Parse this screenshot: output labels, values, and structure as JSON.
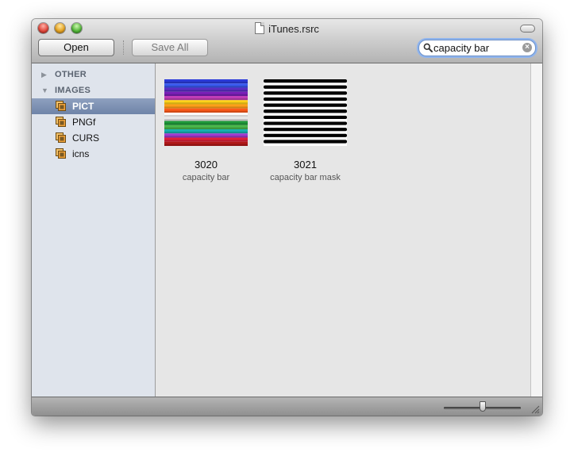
{
  "window": {
    "title": "iTunes.rsrc"
  },
  "toolbar": {
    "open_label": "Open",
    "save_all_label": "Save All"
  },
  "search": {
    "query": "capacity bar"
  },
  "sidebar": {
    "groups": [
      {
        "label": "OTHER",
        "expanded": false
      },
      {
        "label": "IMAGES",
        "expanded": true
      }
    ],
    "items": [
      {
        "label": "PICT",
        "selected": true
      },
      {
        "label": "PNGf",
        "selected": false
      },
      {
        "label": "CURS",
        "selected": false
      },
      {
        "label": "icns",
        "selected": false
      }
    ]
  },
  "resources": [
    {
      "id": "3020",
      "name": "capacity bar",
      "thumbnail": "rainbow-stripes"
    },
    {
      "id": "3021",
      "name": "capacity bar mask",
      "thumbnail": "black-white-stripes"
    }
  ],
  "zoom": {
    "level": 0.5
  },
  "icons": {
    "search": "magnifier-icon",
    "clear": "clear-search-icon",
    "resource_type": "resource-type-icon",
    "document": "document-icon",
    "resize": "resize-grip-icon"
  },
  "colors": {
    "selection": "#7b8fb3",
    "sidebar_bg": "#dfe4ec",
    "content_bg": "#e6e6e6",
    "stripes": [
      "#2b3bd9",
      "#3a5bf0",
      "#5a2fc4",
      "#7a1fb8",
      "#c23db8",
      "#ffd21a",
      "#ff9f1a",
      "#ff5a1a",
      "#ffffff",
      "#e8e8e8",
      "#1f9a3a",
      "#4bb84a",
      "#17b0b0",
      "#a03bd0",
      "#e0203a",
      "#b01818"
    ]
  }
}
